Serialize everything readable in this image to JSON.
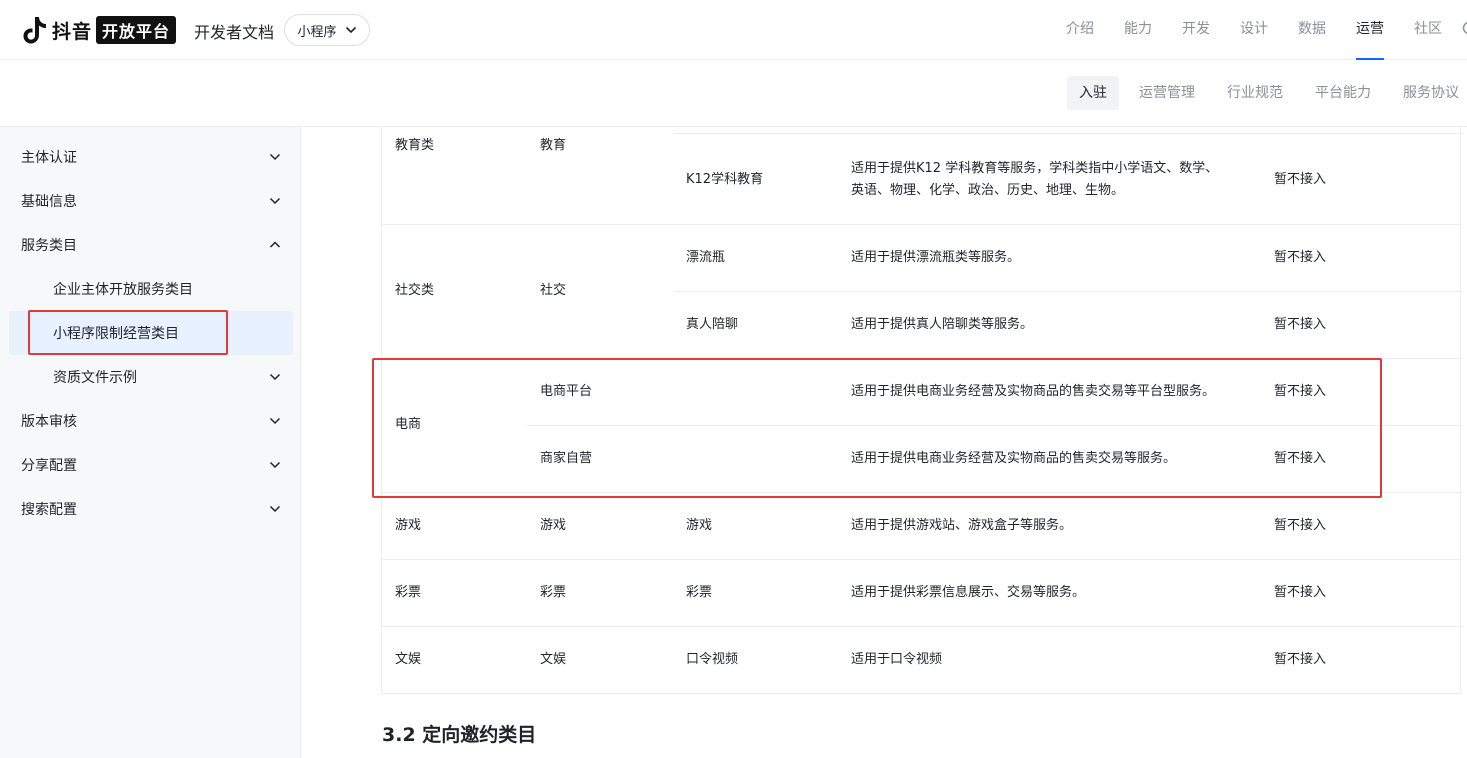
{
  "header": {
    "logo_text": "抖音",
    "logo_badge": "开放平台",
    "doc_title": "开发者文档",
    "selector_value": "小程序",
    "nav": [
      "介绍",
      "能力",
      "开发",
      "设计",
      "数据",
      "运营",
      "社区"
    ],
    "nav_active": "运营"
  },
  "subnav": {
    "items": [
      "入驻",
      "运营管理",
      "行业规范",
      "平台能力",
      "服务协议"
    ],
    "active": "入驻"
  },
  "sidebar": {
    "items": [
      "主体认证",
      "基础信息",
      "服务类目",
      "企业主体开放服务类目",
      "小程序限制经营类目",
      "资质文件示例",
      "版本审核",
      "分享配置",
      "搜索配置"
    ],
    "selected": "小程序限制经营类目"
  },
  "table": {
    "rows": {
      "edu": {
        "cat1": "教育类",
        "cat2": "教育",
        "cat3": "K12学科教育",
        "desc_line1": "适用于提供K12 学科教育等服务，学科类指中小学语文、数学、",
        "desc_line2": "英语、物理、化学、政治、历史、地理、生物。",
        "status": "暂不接入"
      },
      "social": {
        "cat1": "社交类",
        "cat2": "社交",
        "sub1": "漂流瓶",
        "desc1": "适用于提供漂流瓶类等服务。",
        "status1": "暂不接入",
        "sub2": "真人陪聊",
        "desc2": "适用于提供真人陪聊类等服务。",
        "status2": "暂不接入"
      },
      "ecom": {
        "cat1": "电商",
        "sub1": "电商平台",
        "desc1": "适用于提供电商业务经营及实物商品的售卖交易等平台型服务。",
        "status1": "暂不接入",
        "sub2": "商家自营",
        "desc2": "适用于提供电商业务经营及实物商品的售卖交易等服务。",
        "status2": "暂不接入"
      },
      "game": {
        "cat1": "游戏",
        "cat2": "游戏",
        "cat3": "游戏",
        "desc": "适用于提供游戏站、游戏盒子等服务。",
        "status": "暂不接入"
      },
      "lottery": {
        "cat1": "彩票",
        "cat2": "彩票",
        "cat3": "彩票",
        "desc": "适用于提供彩票信息展示、交易等服务。",
        "status": "暂不接入"
      },
      "ent": {
        "cat1": "文娱",
        "cat2": "文娱",
        "cat3": "口令视频",
        "desc": "适用于口令视频",
        "status": "暂不接入"
      }
    }
  },
  "section_title": "3.2 定向邀约类目",
  "colors": {
    "accent": "#1664ff",
    "highlight": "#e53935",
    "selected_bg": "#e8f1ff"
  }
}
